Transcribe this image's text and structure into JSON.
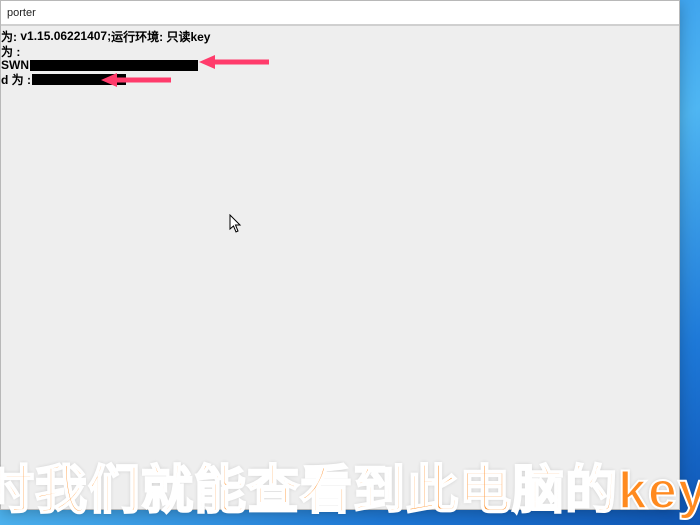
{
  "window": {
    "title_suffix": "porter"
  },
  "lines": {
    "l1_prefix": "为:",
    "l1_version": "v1.15.06221407",
    "l1_sep": " ; ",
    "l1_env_label": "运行环境:",
    "l1_env_value": "只读key",
    "l2_prefix": "为 :",
    "l3_prefix": "SWN",
    "l4_prefix": "d 为 :"
  },
  "caption": "时我们就能查看到此电脑的key",
  "colors": {
    "arrow": "#ff3b6b",
    "caption": "#ff8a1f"
  }
}
